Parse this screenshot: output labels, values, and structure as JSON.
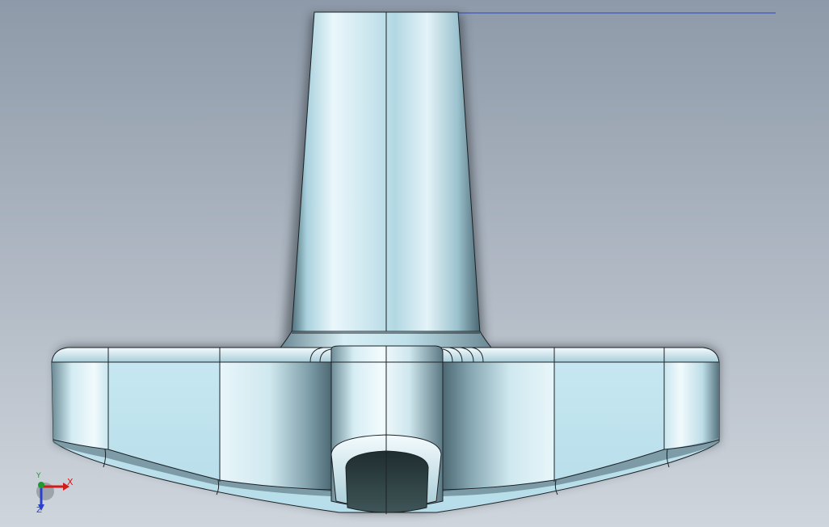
{
  "viewport": {
    "background_top": "#8e9aa9",
    "background_bottom": "#cfd5dc"
  },
  "model": {
    "body_light": "#eaf6fb",
    "body_mid": "#bfe0ea",
    "body_dark": "#5f7d88",
    "pocket_dark": "#2c3e40",
    "edge_color": "#1c2226"
  },
  "reference_line": {
    "color": "#2b46c8"
  },
  "triad": {
    "x_label": "X",
    "y_label": "Y",
    "z_label": "Z",
    "x_color": "#d41a1a",
    "y_color": "#1e9a32",
    "z_color": "#2a3fcf"
  }
}
